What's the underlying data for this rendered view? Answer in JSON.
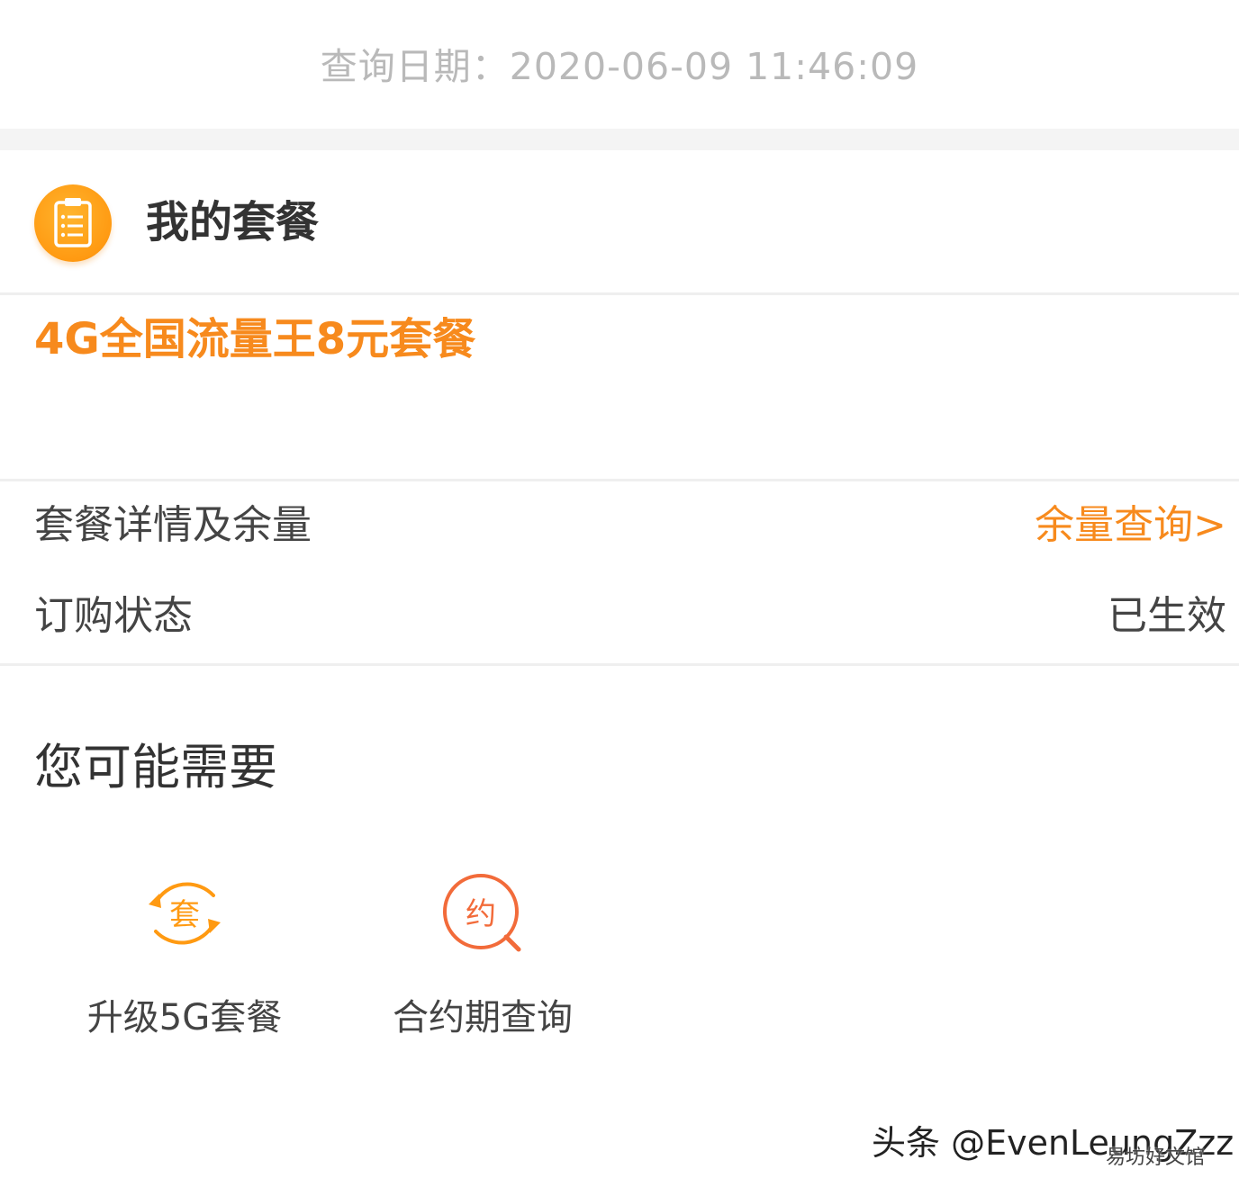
{
  "query_date": "查询日期：2020-06-09 11:46:09",
  "plan_section": {
    "icon": "clipboard-icon",
    "title": "我的套餐",
    "plan_name": "4G全国流量王8元套餐"
  },
  "detail_rows": {
    "detail": {
      "label": "套餐详情及余量",
      "action": "余量查询>"
    },
    "status": {
      "label": "订购状态",
      "value": "已生效"
    }
  },
  "suggestions": {
    "title": "您可能需要",
    "items": [
      {
        "icon": "upgrade-plan-icon",
        "icon_char": "套",
        "label": "升级5G套餐"
      },
      {
        "icon": "contract-search-icon",
        "icon_char": "约",
        "label": "合约期查询"
      }
    ]
  },
  "watermark": {
    "main": "头条 @EvenLeungZzz",
    "sub": "易坊好文馆"
  },
  "colors": {
    "accent": "#f78a1d",
    "icon_orange": "#ff9a12",
    "contract_red": "#f26b3a",
    "muted_text": "#b9b9b9",
    "body_text": "#333333"
  }
}
